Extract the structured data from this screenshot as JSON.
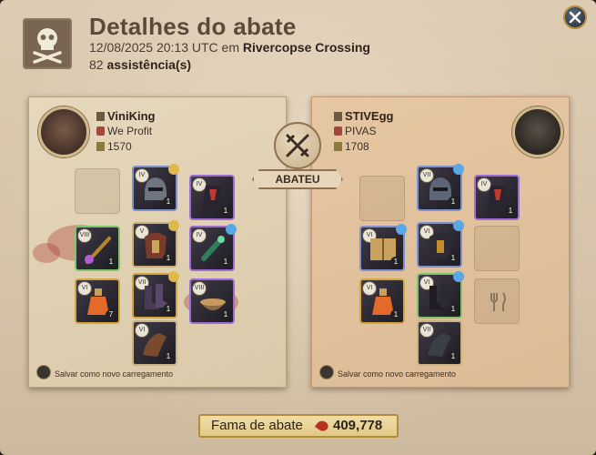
{
  "header": {
    "title": "Detalhes do abate",
    "datetime": "12/08/2025 20:13 UTC em",
    "location": "Rivercopse Crossing",
    "assist_count": "82",
    "assist_label": "assistência(s)"
  },
  "killer": {
    "name": "ViniKing",
    "guild": "We Profit",
    "ip": "1570",
    "save_label": "Salvar como novo carregamento"
  },
  "victim": {
    "name": "STIVEgg",
    "guild": "PIVAS",
    "ip": "1708",
    "save_label": "Salvar como novo carregamento"
  },
  "center": {
    "badge": "ABATEU"
  },
  "fame": {
    "label": "Fama de abate",
    "value": "409,778"
  },
  "colors": {
    "killer_panel": "#dac9a9",
    "victim_panel": "#dcbb95",
    "fame_bar": "#e2c988"
  },
  "icons": [
    "close-icon",
    "skull-icon",
    "crossed-swords-icon",
    "blood-drop-icon"
  ],
  "killer_slots": {
    "bag": {
      "tier": "",
      "qty": ""
    },
    "head": {
      "tier": "IV",
      "qty": "1"
    },
    "cape": {
      "tier": "IV",
      "qty": "1"
    },
    "mainhand": {
      "tier": "VIII",
      "qty": "1"
    },
    "armor": {
      "tier": "V",
      "qty": "1"
    },
    "offhand": {
      "tier": "IV",
      "qty": "1"
    },
    "potion": {
      "tier": "VI",
      "qty": "7"
    },
    "shoes": {
      "tier": "VII",
      "qty": "1"
    },
    "food": {
      "tier": "VIII",
      "qty": "1"
    },
    "mount": {
      "tier": "VI",
      "qty": "1"
    }
  },
  "victim_slots": {
    "head": {
      "tier": "VII",
      "qty": "1"
    },
    "cape": {
      "tier": "IV",
      "qty": "1"
    },
    "mainhand": {
      "tier": "VI",
      "qty": "1"
    },
    "armor": {
      "tier": "VI",
      "qty": "1"
    },
    "potion": {
      "tier": "VI",
      "qty": "1"
    },
    "shoes": {
      "tier": "VI",
      "qty": "1"
    },
    "mount": {
      "tier": "VII",
      "qty": "1"
    }
  }
}
